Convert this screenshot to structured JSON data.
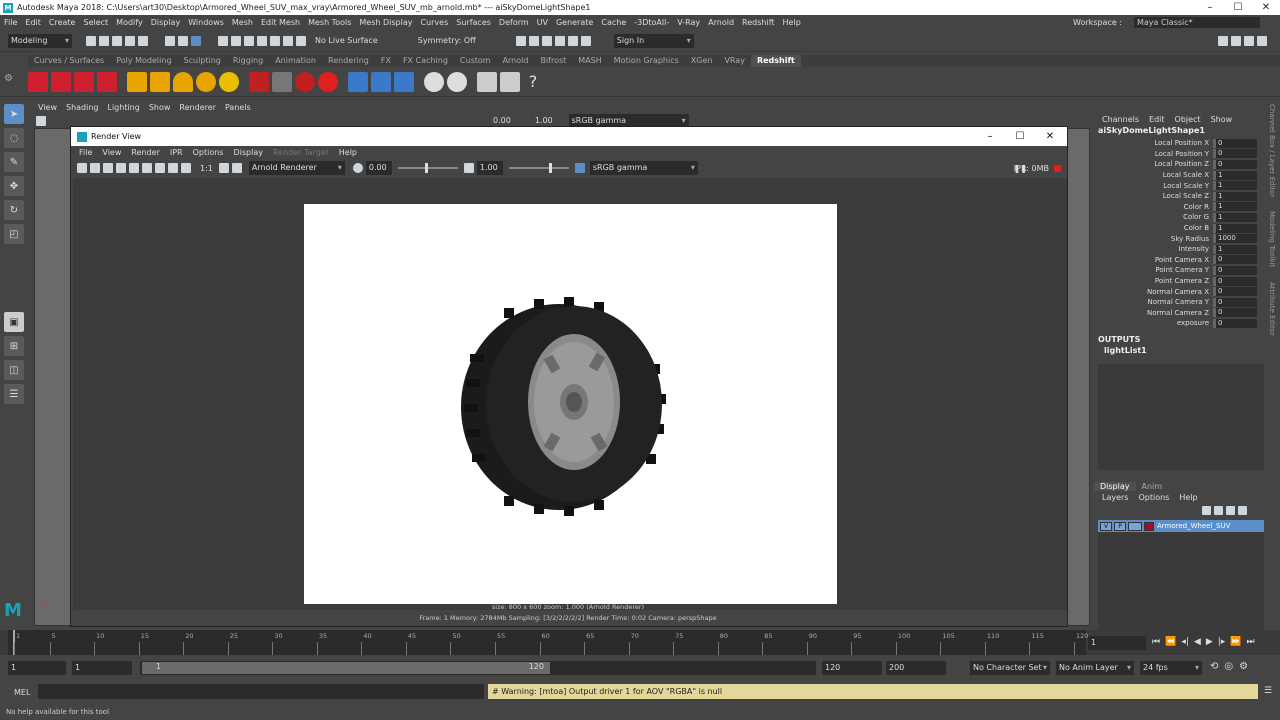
{
  "window": {
    "title": "Autodesk Maya 2018: C:\\Users\\art30\\Desktop\\Armored_Wheel_SUV_max_vray\\Armored_Wheel_SUV_mb_arnold.mb*   ---   aiSkyDomeLightShape1"
  },
  "menubar": {
    "items": [
      "File",
      "Edit",
      "Create",
      "Select",
      "Modify",
      "Display",
      "Windows",
      "Mesh",
      "Edit Mesh",
      "Mesh Tools",
      "Mesh Display",
      "Curves",
      "Surfaces",
      "Deform",
      "UV",
      "Generate",
      "Cache",
      "-3DtoAll-",
      "V-Ray",
      "Arnold",
      "Redshift",
      "Help"
    ],
    "workspace_label": "Workspace :",
    "workspace_value": "Maya Classic*"
  },
  "statusline": {
    "mode": "Modeling",
    "live_surface": "No Live Surface",
    "symmetry": "Symmetry: Off",
    "sign_in": "Sign In"
  },
  "shelf": {
    "tabs": [
      "Curves / Surfaces",
      "Poly Modeling",
      "Sculpting",
      "Rigging",
      "Animation",
      "Rendering",
      "FX",
      "FX Caching",
      "Custom",
      "Arnold",
      "Bifrost",
      "MASH",
      "Motion Graphics",
      "XGen",
      "VRay",
      "Redshift"
    ],
    "active": "Redshift"
  },
  "panel": {
    "menu": [
      "View",
      "Shading",
      "Lighting",
      "Show",
      "Renderer",
      "Panels"
    ],
    "exposure": "0.00",
    "gamma": "1.00",
    "colorspace": "sRGB gamma"
  },
  "render_view": {
    "title": "Render View",
    "menu": [
      "File",
      "View",
      "Render",
      "IPR",
      "Options",
      "Display",
      "Render Target",
      "Help"
    ],
    "renderer": "Arnold Renderer",
    "ratio": "1:1",
    "exposure": "0.00",
    "gamma": "1.00",
    "colorspace": "sRGB gamma",
    "ipr": "IPR: 0MB",
    "status_line1": "size: 800 x 600  zoom: 1.000       (Arnold Renderer)",
    "status_line2": "Frame: 1      Memory: 2784Mb      Sampling: [3/2/2/2/2/2]      Render Time: 0:02      Camera: perspShape"
  },
  "channel_box": {
    "menu": [
      "Channels",
      "Edit",
      "Object",
      "Show"
    ],
    "node": "aiSkyDomeLightShape1",
    "attributes": [
      {
        "name": "Local Position X",
        "value": "0"
      },
      {
        "name": "Local Position Y",
        "value": "0"
      },
      {
        "name": "Local Position Z",
        "value": "0"
      },
      {
        "name": "Local Scale X",
        "value": "1"
      },
      {
        "name": "Local Scale Y",
        "value": "1"
      },
      {
        "name": "Local Scale Z",
        "value": "1"
      },
      {
        "name": "Color R",
        "value": "1"
      },
      {
        "name": "Color G",
        "value": "1"
      },
      {
        "name": "Color B",
        "value": "1"
      },
      {
        "name": "Sky Radius",
        "value": "1000"
      },
      {
        "name": "Intensity",
        "value": "1"
      },
      {
        "name": "Point Camera X",
        "value": "0"
      },
      {
        "name": "Point Camera Y",
        "value": "0"
      },
      {
        "name": "Point Camera Z",
        "value": "0"
      },
      {
        "name": "Normal Camera X",
        "value": "0"
      },
      {
        "name": "Normal Camera Y",
        "value": "0"
      },
      {
        "name": "Normal Camera Z",
        "value": "0"
      },
      {
        "name": "exposure",
        "value": "0"
      }
    ],
    "outputs_label": "OUTPUTS",
    "outputs_item": "lightList1",
    "display_tabs": [
      "Display",
      "Anim"
    ],
    "layer_menu": [
      "Layers",
      "Options",
      "Help"
    ],
    "layer": {
      "v": "V",
      "p": "P",
      "name": "Armored_Wheel_SUV",
      "color": "#a0102a"
    }
  },
  "side_tabs": [
    "Channel Box / Layer Editor",
    "Modeling Toolkit",
    "Attribute Editor"
  ],
  "timeline": {
    "ticks": [
      "1",
      "5",
      "10",
      "15",
      "20",
      "25",
      "30",
      "35",
      "40",
      "45",
      "50",
      "55",
      "60",
      "65",
      "70",
      "75",
      "80",
      "85",
      "90",
      "95",
      "100",
      "105",
      "110",
      "115",
      "120"
    ],
    "current_frame": "1"
  },
  "range": {
    "start": "1",
    "playback_start": "1",
    "slider_start": "1",
    "slider_end": "120",
    "playback_end": "120",
    "end": "200",
    "character_set": "No Character Set",
    "anim_layer": "No Anim Layer",
    "fps": "24 fps"
  },
  "command": {
    "label": "MEL",
    "warning": "# Warning: [mtoa] Output driver 1 for AOV \"RGBA\" is null"
  },
  "help_line": "No help available for this tool"
}
